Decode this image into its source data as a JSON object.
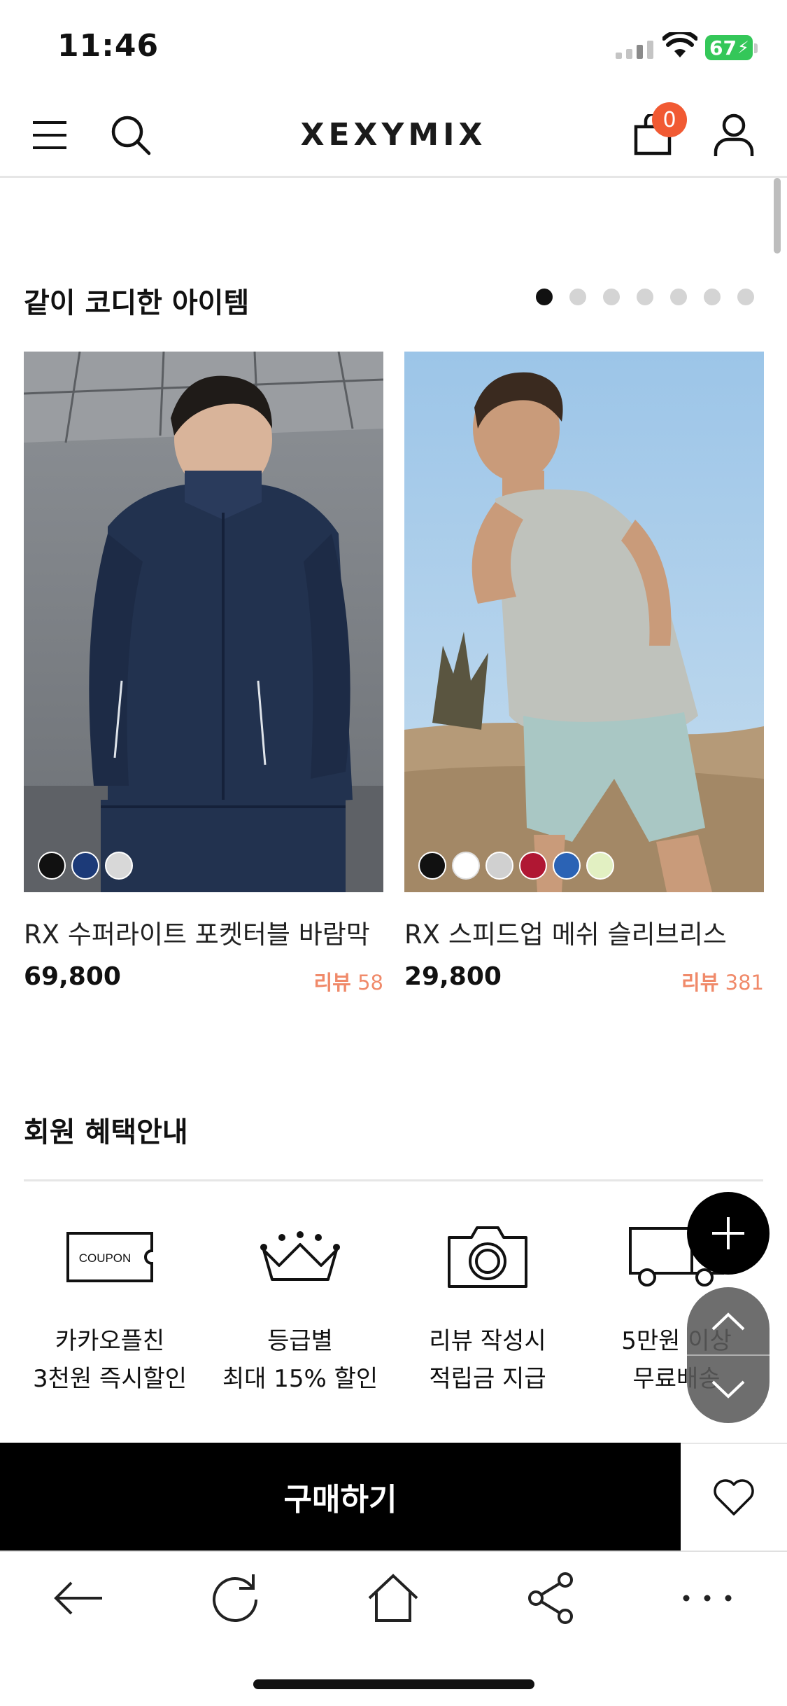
{
  "status_bar": {
    "time": "11:46",
    "battery": "67"
  },
  "header": {
    "brand": "XEXYMIX",
    "cart_count": "0",
    "icons": [
      "menu-icon",
      "search-icon",
      "cart-icon",
      "user-icon"
    ]
  },
  "coordi_section": {
    "title": "같이 코디한 아이템",
    "page_count": 7,
    "active_page": 1,
    "products": [
      {
        "name": "RX 수퍼라이트 포켓터블 바람막",
        "price": "69,800",
        "review_label": "리뷰",
        "review_count": "58",
        "swatches": [
          "#111111",
          "#1c3a78",
          "#d8d8d8"
        ]
      },
      {
        "name": "RX 스피드업 메쉬 슬리브리스",
        "price": "29,800",
        "review_label": "리뷰",
        "review_count": "381",
        "swatches": [
          "#111111",
          "#ffffff",
          "#d0d0d0",
          "#b01733",
          "#2b63b5",
          "#e2f0c2"
        ]
      }
    ]
  },
  "benefits_section": {
    "title": "회원 혜택안내",
    "items": [
      {
        "icon": "coupon-icon",
        "icon_text": "COUPON",
        "line1": "카카오플친",
        "line2": "3천원 즉시할인"
      },
      {
        "icon": "crown-icon",
        "line1": "등급별",
        "line2": "최대 15% 할인"
      },
      {
        "icon": "camera-icon",
        "line1": "리뷰 작성시",
        "line2": "적립금 지급"
      },
      {
        "icon": "truck-icon",
        "line1": "5만원 이상",
        "line2": "무료배송"
      }
    ]
  },
  "actions": {
    "buy_label": "구매하기"
  },
  "colors": {
    "accent_badge": "#f15a33",
    "review_text": "#f08a6a",
    "battery": "#34c759"
  }
}
